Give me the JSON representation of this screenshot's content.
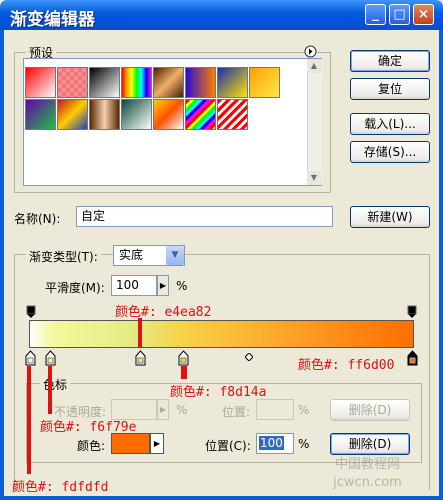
{
  "window": {
    "title": "渐变编辑器",
    "min_label": "_",
    "max_label": "□",
    "close_label": "×"
  },
  "presets": {
    "label": "预设",
    "menu_icon": "circle-arrow-right-icon"
  },
  "buttons": {
    "ok": "确定",
    "reset": "复位",
    "load": "载入(L)...",
    "save": "存储(S)...",
    "new": "新建(W)",
    "delete": "删除(D)",
    "delete_disabled": "删除(D)"
  },
  "name": {
    "label": "名称(N):",
    "value": "自定"
  },
  "gradient": {
    "type_label": "渐变类型(T):",
    "type_value": "实底",
    "smooth_label": "平滑度(M):",
    "smooth_value": "100",
    "smooth_unit": "%"
  },
  "stops_group": {
    "label": "色标",
    "opacity_label": "不透明度:",
    "opacity_unit": "%",
    "opacity_location_label": "位置:",
    "opacity_location_unit": "%",
    "color_label": "颜色:",
    "color_value": "#ff6d00",
    "location_label": "位置(C):",
    "location_value": "100",
    "location_unit": "%"
  },
  "annotations": {
    "a1": "颜色#: e4ea82",
    "a2": "颜色#: ff6d00",
    "a3": "颜色#: f8d14a",
    "a4": "颜色#: f6f79e",
    "a5": "颜色#: fdfdfd"
  },
  "watermark": "中国教程网 jcwcn.com",
  "colors": {
    "stop1": "#fdfdfd",
    "stop2": "#f6f79e",
    "stop3": "#e4ea82",
    "stop4": "#f8d14a",
    "stop5": "#ff6d00",
    "annotation": "#e01010"
  }
}
